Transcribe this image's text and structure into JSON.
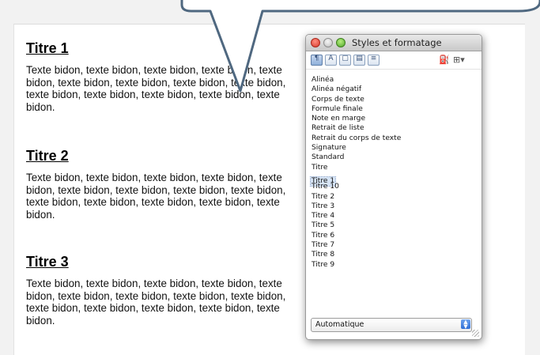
{
  "document": {
    "sections": [
      {
        "heading": "Titre 1",
        "body": "Texte bidon, texte bidon, texte bidon, texte bidon, texte\nbidon, texte bidon, texte bidon, texte bidon, texte bidon,\ntexte bidon, texte bidon, texte bidon, texte bidon, texte\nbidon."
      },
      {
        "heading": "Titre 2",
        "body": "Texte bidon, texte bidon, texte bidon, texte bidon, texte\nbidon, texte bidon, texte bidon, texte bidon, texte bidon,\ntexte bidon, texte bidon, texte bidon, texte bidon, texte\nbidon."
      },
      {
        "heading": "Titre 3",
        "body": "Texte bidon, texte bidon, texte bidon, texte bidon, texte\nbidon, texte bidon, texte bidon, texte bidon, texte bidon,\ntexte bidon, texte bidon, texte bidon, texte bidon, texte\nbidon."
      }
    ]
  },
  "panel": {
    "title": "Styles et formatage",
    "toolbar": {
      "buttons": [
        {
          "icon": "paragraph-styles-icon",
          "glyph": "¶",
          "active": true
        },
        {
          "icon": "character-styles-icon",
          "glyph": "A",
          "active": false
        },
        {
          "icon": "frame-styles-icon",
          "glyph": "▢",
          "active": false
        },
        {
          "icon": "page-styles-icon",
          "glyph": "▤",
          "active": false
        },
        {
          "icon": "list-styles-icon",
          "glyph": "≡",
          "active": false
        }
      ],
      "fill_format_icon": "paint-bucket-icon",
      "new_style_icon": "new-style-icon"
    },
    "styles": [
      "Alinéa",
      "Alinéa négatif",
      "Corps de texte",
      "Formule finale",
      "Note en marge",
      "Retrait de liste",
      "Retrait du corps de texte",
      "Signature",
      "Standard",
      "Titre",
      "Titre 1",
      "Titre 10",
      "Titre 2",
      "Titre 3",
      "Titre 4",
      "Titre 5",
      "Titre 6",
      "Titre 7",
      "Titre 8",
      "Titre 9"
    ],
    "selected_style": "Titre 1",
    "filter_select": {
      "value": "Automatique"
    }
  },
  "colors": {
    "callout_stroke": "#4f6880",
    "selection": "#d6e4f5",
    "accent_blue": "#2f6fd6"
  }
}
